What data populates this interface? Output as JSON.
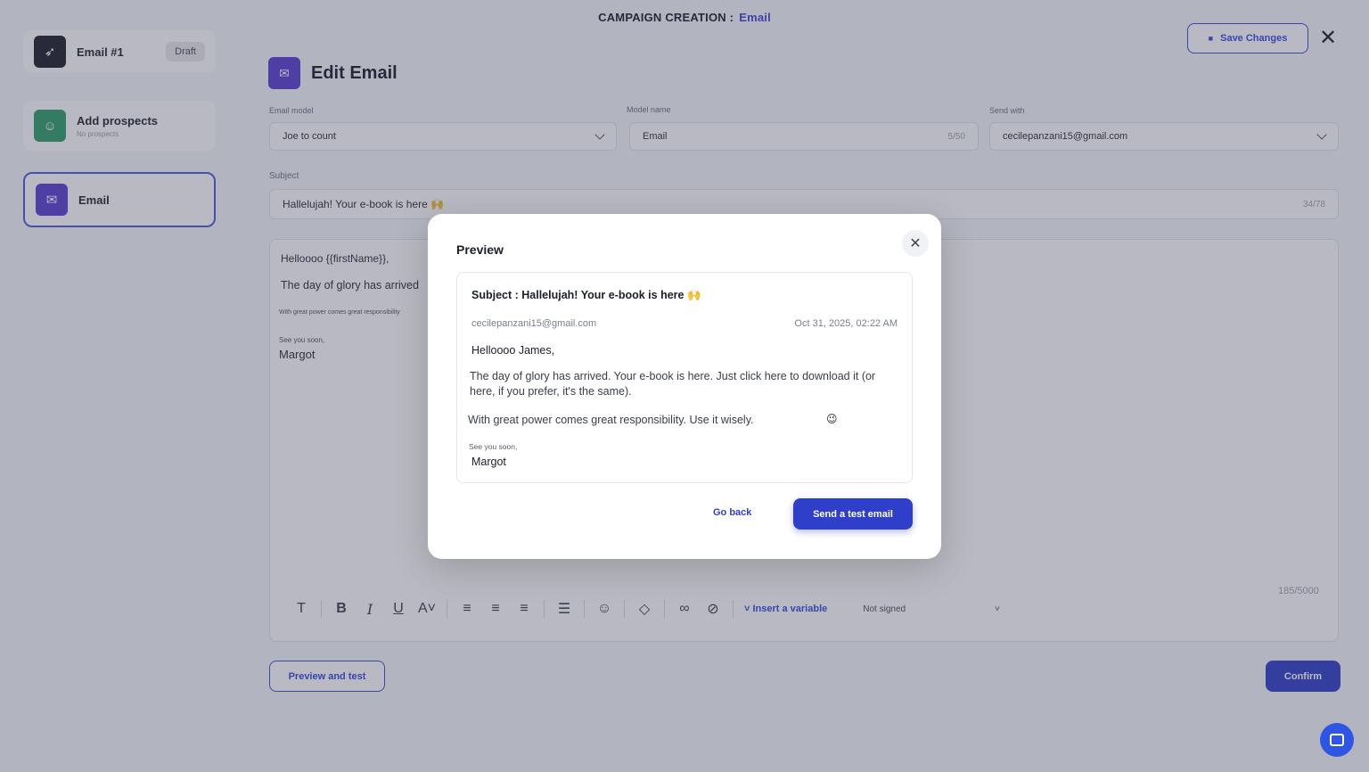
{
  "header": {
    "title_prefix": "CAMPAIGN CREATION :",
    "title_accent": "Email"
  },
  "sidebar": {
    "steps": [
      {
        "label": "Email #1",
        "badge": "Draft"
      },
      {
        "label": "Add prospects",
        "sub": "No prospects"
      },
      {
        "label": "Email"
      }
    ]
  },
  "toolbar_top": {
    "save_label": "Save Changes",
    "close_glyph": "✕"
  },
  "edit": {
    "title": "Edit Email",
    "email_model_label": "Email model",
    "email_model_value": "Joe to count",
    "model_name_label": "Model name",
    "model_name_value": "Email",
    "model_name_count": "5/50",
    "send_with_label": "Send with",
    "send_with_value": "cecilepanzani15@gmail.com",
    "subject_label": "Subject",
    "subject_value": "Hallelujah! Your e-book is here 🙌",
    "subject_count": "34/78"
  },
  "editor": {
    "line1": "Helloooo {{firstName}},",
    "line2": "The day of glory has arrived",
    "line3": "With great power comes great responsibility",
    "line4": "See you soon,",
    "line5": "Margot",
    "char_count": "185/5000",
    "insert_variable": "Insert a variable",
    "signature": "Not signed"
  },
  "footer": {
    "preview_label": "Preview and test",
    "confirm_label": "Confirm"
  },
  "modal": {
    "title": "Preview",
    "subject": "Subject : Hallelujah! Your e-book is here 🙌",
    "from": "cecilepanzani15@gmail.com",
    "date": "Oct 31, 2025, 02:22 AM",
    "greeting": "Helloooo James,",
    "paragraph1": "The day of glory has arrived. Your e-book is here. Just click here to download it (or here, if you prefer, it's the same).",
    "paragraph2": "With great power comes great responsibility. Use it wisely.",
    "emoji": "😉",
    "see_you": "See you soon,",
    "signature": "Margot",
    "go_back": "Go back",
    "send_test": "Send a test email"
  },
  "colors": {
    "accent": "#2f3fc9",
    "purple": "#5b3fd0",
    "green": "#2f9e6a"
  }
}
